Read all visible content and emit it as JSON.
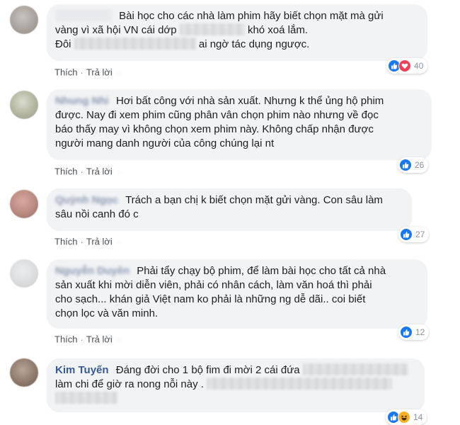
{
  "comments": [
    {
      "id": "c1",
      "author": "",
      "lines": [
        [
          "Bài học cho các nhà làm phim hãy biết chọn mặt mà gửi"
        ],
        [
          "vàng vì xã hội VN cái dớp ",
          "khó xoá lắm."
        ],
        [
          "Đôi ",
          "ai ngờ tác dụng ngược."
        ]
      ],
      "actions": {
        "like": "Thích",
        "reply": "Trả lời"
      },
      "reactions": {
        "icons": [
          "like",
          "love"
        ],
        "count": "40"
      }
    },
    {
      "id": "c2",
      "author": "",
      "lines": [
        [
          "Hơi bất công với nhà sản xuất. Nhưng k thể ủng hộ phim"
        ],
        [
          "được. Nay đi xem phim cũng phân vân chọn phim nào nhưng về đọc"
        ],
        [
          "báo thấy may vì không chọn xem phim này. Không chấp nhận được"
        ],
        [
          "người mang danh người của công chúng lại nt"
        ]
      ],
      "actions": {
        "like": "Thích",
        "reply": "Trả lời"
      },
      "reactions": {
        "icons": [
          "like"
        ],
        "count": "26"
      }
    },
    {
      "id": "c3",
      "author": "",
      "lines": [
        [
          "Trách a bạn chị k biết chọn mặt gửi vàng. Con sâu làm"
        ],
        [
          "sâu nồi canh đó c"
        ]
      ],
      "actions": {
        "like": "Thích",
        "reply": "Trả lời"
      },
      "reactions": {
        "icons": [
          "like"
        ],
        "count": "27"
      }
    },
    {
      "id": "c4",
      "author": "",
      "lines": [
        [
          "Phải tẩy chạy bộ phim, để làm bài học cho tất cả nhà"
        ],
        [
          "sản xuất khi mời diễn viên, phải có nhân cách, làm văn hoá thì phải"
        ],
        [
          "cho sạch... khán giả Việt nam ko phải là những ng dễ dãi.. coi biết"
        ],
        [
          "chọn lọc và văn minh."
        ]
      ],
      "actions": {
        "like": "Thích",
        "reply": "Trả lời"
      },
      "reactions": {
        "icons": [
          "like"
        ],
        "count": "12"
      }
    },
    {
      "id": "c5",
      "author": "Kim Tuyến",
      "lines": [
        [
          "Đáng đời cho 1 bộ fim đi mời 2 cái đứa "
        ],
        [
          "làm chi để giờ ra nong nỗi này . ",
          ""
        ],
        [
          ""
        ]
      ],
      "actions": {
        "like": "Thích",
        "reply": "Trả lời"
      },
      "reactions": {
        "icons": [
          "like",
          "haha"
        ],
        "count": "14"
      }
    }
  ],
  "colors": {
    "like": "#1877f2",
    "love": "#f33e58",
    "haha": "#f7b125",
    "author": "#385898",
    "bubble": "#f2f3f5"
  }
}
